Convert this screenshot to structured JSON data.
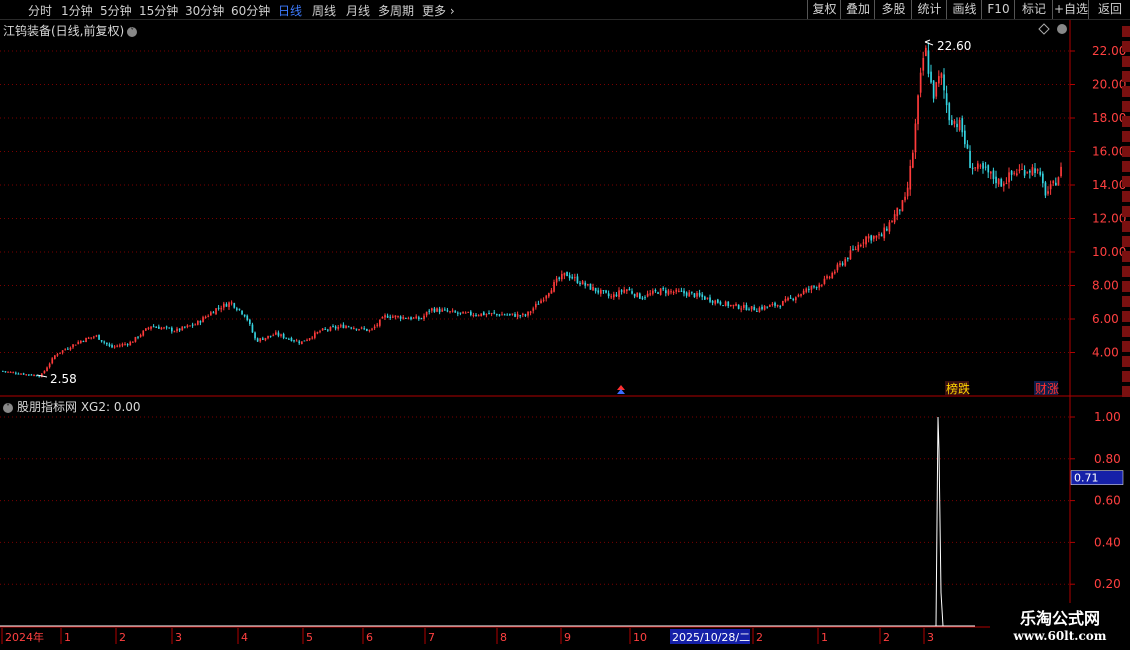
{
  "toolbar": {
    "periods": [
      "分时",
      "1分钟",
      "5分钟",
      "15分钟",
      "30分钟",
      "60分钟",
      "日线",
      "周线",
      "月线",
      "多周期",
      "更多 ›"
    ],
    "active_period": "日线",
    "actions": [
      "复权",
      "叠加",
      "多股",
      "统计",
      "画线",
      "F10",
      "标记",
      "+自选",
      "返回"
    ]
  },
  "stock": {
    "title": "江钨装备(日线,前复权)",
    "high_label": "22.60",
    "low_label": "2.58",
    "badges": [
      {
        "text": "榜跌",
        "color": "#ffd400",
        "bg": "#3a1010"
      },
      {
        "text": "财涨",
        "color": "#ff3030",
        "bg": "#0e1e4a"
      }
    ]
  },
  "indicator": {
    "title": "股朋指标网  XG2: 0.00",
    "cursor_value": "0.71"
  },
  "axis": {
    "price_ticks": [
      "22.00",
      "20.00",
      "18.00",
      "16.00",
      "14.00",
      "12.00",
      "10.00",
      "8.00",
      "6.00",
      "4.00"
    ],
    "indicator_ticks": [
      "1.00",
      "0.80",
      "0.60",
      "0.40",
      "0.20"
    ],
    "date_labels": [
      "2024年",
      "1",
      "2",
      "3",
      "4",
      "5",
      "6",
      "7",
      "8",
      "9",
      "10",
      "2025/10/28/二",
      "2",
      "1",
      "2",
      "3"
    ]
  },
  "watermark": {
    "line1": "乐淘公式网",
    "line2": "www.60lt.com"
  },
  "colors": {
    "up": "#ff3b3b",
    "down": "#35d3e0",
    "grid": "#7a0000",
    "axis": "#b00000",
    "cursor_bg": "#1520a8"
  },
  "chart_data": {
    "type": "candlestick",
    "price_range": [
      2.0,
      23.0
    ],
    "close_anchors": [
      [
        0,
        2.9
      ],
      [
        25,
        2.7
      ],
      [
        40,
        2.6
      ],
      [
        55,
        3.9
      ],
      [
        80,
        4.7
      ],
      [
        95,
        5.0
      ],
      [
        110,
        4.3
      ],
      [
        130,
        4.6
      ],
      [
        150,
        5.6
      ],
      [
        175,
        5.3
      ],
      [
        195,
        5.7
      ],
      [
        215,
        6.6
      ],
      [
        230,
        7.0
      ],
      [
        245,
        6.2
      ],
      [
        255,
        4.7
      ],
      [
        275,
        5.1
      ],
      [
        300,
        4.6
      ],
      [
        320,
        5.3
      ],
      [
        345,
        5.6
      ],
      [
        370,
        5.3
      ],
      [
        385,
        6.2
      ],
      [
        420,
        6.0
      ],
      [
        430,
        6.6
      ],
      [
        460,
        6.3
      ],
      [
        490,
        6.3
      ],
      [
        525,
        6.2
      ],
      [
        540,
        7.1
      ],
      [
        555,
        8.2
      ],
      [
        565,
        8.7
      ],
      [
        585,
        8.0
      ],
      [
        610,
        7.3
      ],
      [
        625,
        7.8
      ],
      [
        640,
        7.3
      ],
      [
        660,
        7.7
      ],
      [
        690,
        7.5
      ],
      [
        730,
        6.8
      ],
      [
        755,
        6.6
      ],
      [
        780,
        6.9
      ],
      [
        805,
        7.7
      ],
      [
        825,
        8.3
      ],
      [
        845,
        9.6
      ],
      [
        865,
        10.9
      ],
      [
        880,
        10.9
      ],
      [
        895,
        12.3
      ],
      [
        905,
        13.1
      ],
      [
        912,
        16.0
      ],
      [
        918,
        19.5
      ],
      [
        924,
        22.3
      ],
      [
        932,
        19.3
      ],
      [
        940,
        20.6
      ],
      [
        948,
        18.1
      ],
      [
        960,
        17.5
      ],
      [
        970,
        15.1
      ],
      [
        985,
        14.8
      ],
      [
        1000,
        14.1
      ],
      [
        1015,
        14.8
      ],
      [
        1035,
        15.0
      ],
      [
        1045,
        13.5
      ],
      [
        1052,
        13.9
      ],
      [
        1062,
        15.1
      ]
    ],
    "indicator_series": {
      "name": "XG2",
      "values": [
        0,
        0,
        1.0,
        0.84,
        0.5,
        0.16,
        0,
        0
      ]
    }
  }
}
